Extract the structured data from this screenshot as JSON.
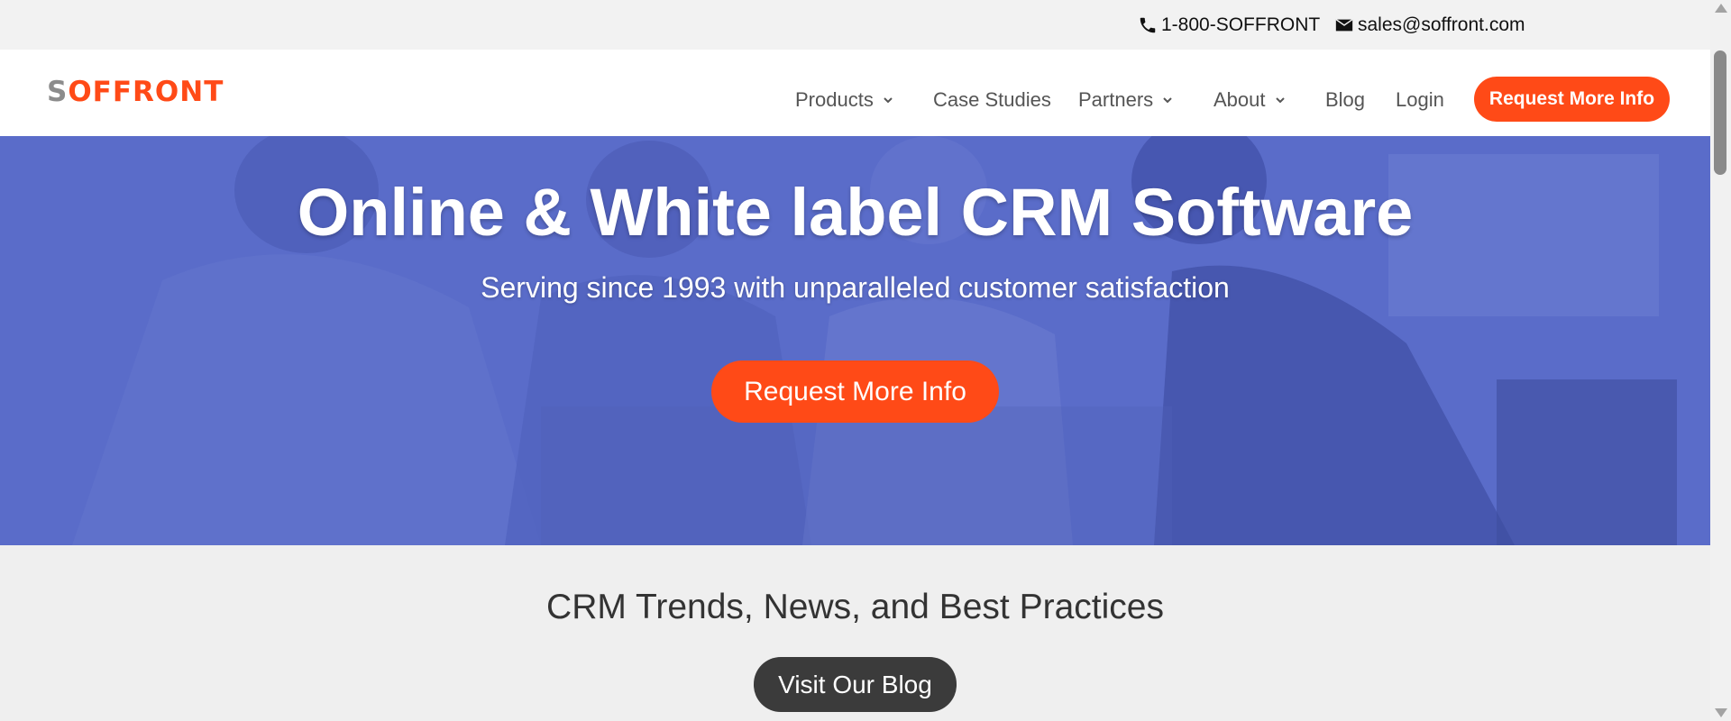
{
  "topbar": {
    "phone": "1-800-SOFFRONT",
    "email": "sales@soffront.com"
  },
  "brand": {
    "logo_first": "S",
    "logo_rest": "OFFRONT",
    "accent": "#ff4a17"
  },
  "nav": {
    "items": [
      {
        "label": "Products",
        "dropdown": true
      },
      {
        "label": "Case Studies",
        "dropdown": false
      },
      {
        "label": "Partners",
        "dropdown": true
      },
      {
        "label": "About",
        "dropdown": true
      },
      {
        "label": "Blog",
        "dropdown": false
      },
      {
        "label": "Login",
        "dropdown": false
      }
    ],
    "cta": "Request More Info"
  },
  "hero": {
    "title": "Online & White label CRM Software",
    "subtitle": "Serving since 1993 with unparalleled customer satisfaction",
    "cta": "Request More Info",
    "overlay_color": "#5a6cc9"
  },
  "blog_section": {
    "heading": "CRM Trends, News, and Best Practices",
    "button": "Visit Our Blog"
  },
  "icons": {
    "phone": "phone-icon",
    "email": "envelope-icon",
    "dropdown": "chevron-down-icon"
  }
}
